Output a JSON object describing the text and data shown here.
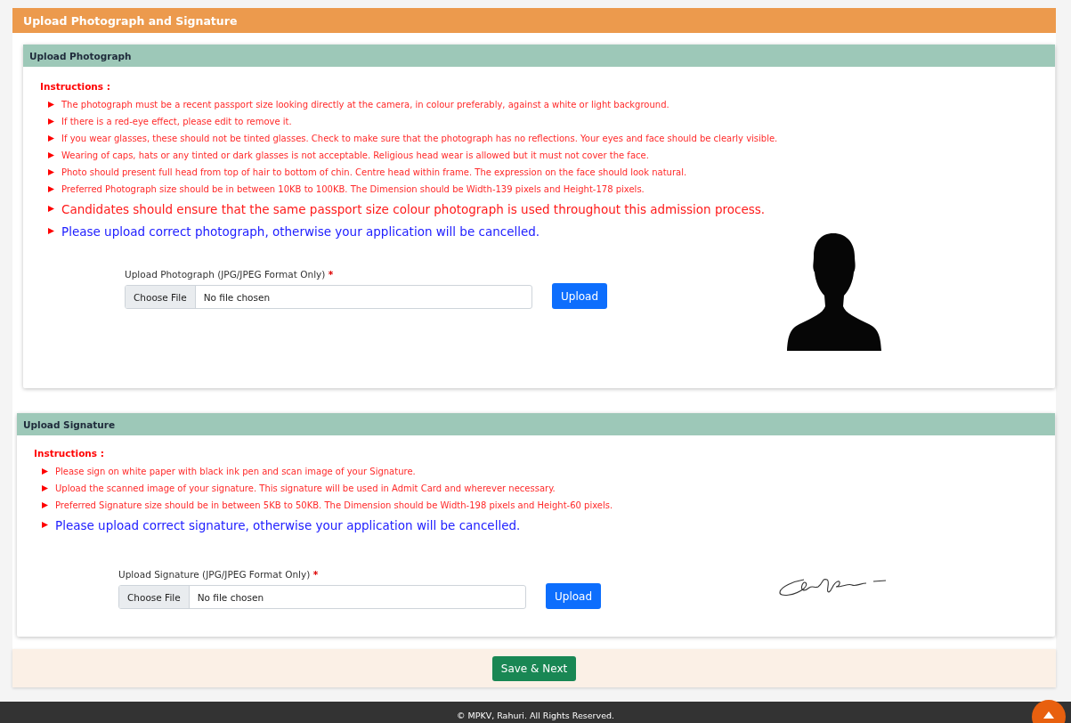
{
  "page_title": "Upload Photograph and Signature",
  "sections": [
    {
      "kind": "photo",
      "title": "Upload Photograph",
      "instructions_label": "Instructions :",
      "instructions": [
        {
          "kind": "small",
          "text": "The photograph must be a recent passport size looking directly at the camera, in colour preferably, against a white or light background."
        },
        {
          "kind": "small",
          "text": "If there is a red-eye effect, please edit to remove it."
        },
        {
          "kind": "small",
          "text": "If you wear glasses, these should not be tinted glasses. Check to make sure that the photograph has no reflections. Your eyes and face should be clearly visible."
        },
        {
          "kind": "small",
          "text": "Wearing of caps, hats or any tinted or dark glasses is not acceptable. Religious head wear is allowed but it must not cover the face."
        },
        {
          "kind": "small",
          "text": "Photo should present full head from top of hair to bottom of chin. Centre head within frame. The expression on the face should look natural."
        },
        {
          "kind": "small",
          "text": "Preferred Photograph size should be in between 10KB to 100KB. The Dimension should be Width-139 pixels and Height-178 pixels."
        },
        {
          "kind": "warning",
          "text": "Candidates should ensure that the same passport size colour photograph is used throughout this admission process."
        },
        {
          "kind": "notice",
          "text": "Please upload correct photograph, otherwise your application will be cancelled."
        }
      ],
      "field_label": "Upload Photograph (JPG/JPEG Format Only)",
      "required_mark": "*",
      "choose_button": "Choose File",
      "file_status": "No file chosen",
      "upload_button": "Upload"
    },
    {
      "kind": "signature",
      "title": "Upload Signature",
      "instructions_label": "Instructions :",
      "instructions": [
        {
          "kind": "small",
          "text": "Please sign on white paper with black ink pen and scan image of your Signature."
        },
        {
          "kind": "small",
          "text": "Upload the scanned image of your signature. This signature will be used in Admit Card and wherever necessary."
        },
        {
          "kind": "small",
          "text": "Preferred Signature size should be in between 5KB to 50KB. The Dimension should be Width-198 pixels and Height-60 pixels."
        },
        {
          "kind": "notice",
          "text": "Please upload correct signature, otherwise your application will be cancelled."
        }
      ],
      "field_label": "Upload Signature (JPG/JPEG Format Only)",
      "required_mark": "*",
      "choose_button": "Choose File",
      "file_status": "No file chosen",
      "upload_button": "Upload"
    }
  ],
  "save_button": "Save & Next",
  "footer": "© MPKV, Rahuri. All Rights Reserved."
}
